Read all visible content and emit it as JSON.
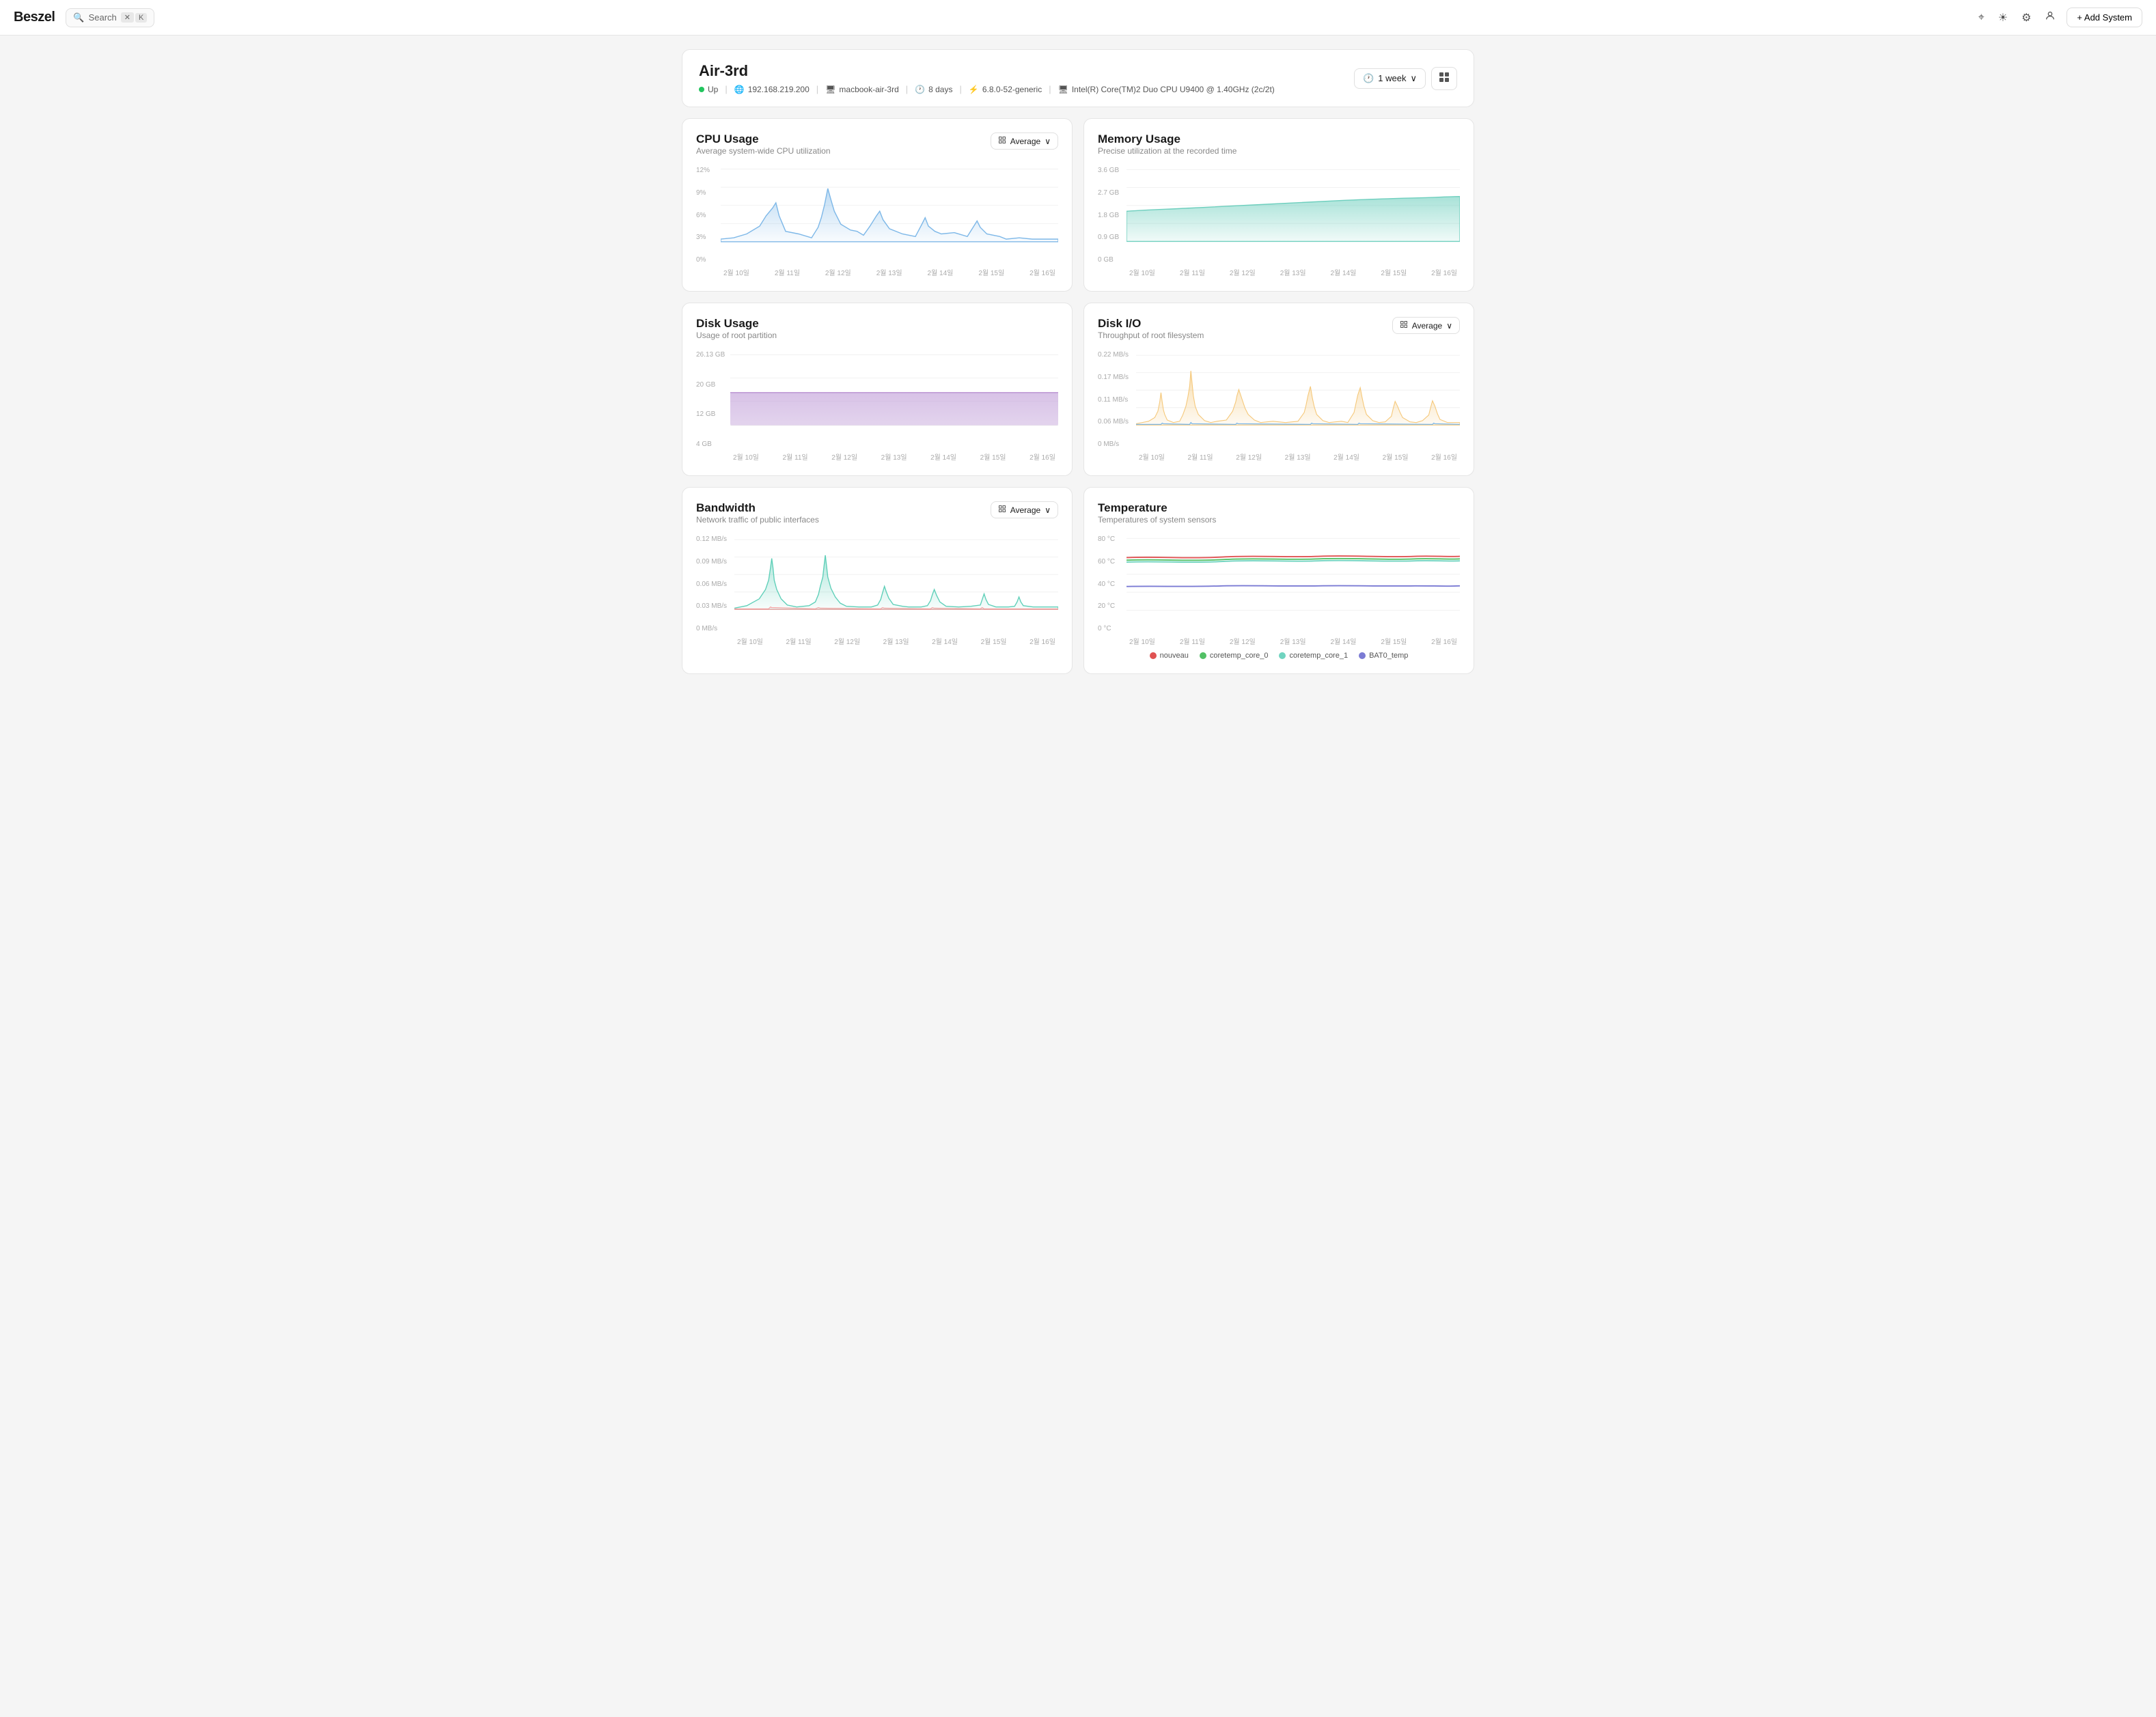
{
  "header": {
    "logo": "Beszel",
    "search": {
      "placeholder": "Search",
      "shortcut_x": "✕",
      "shortcut_k": "K"
    },
    "icons": {
      "translate": "⌖",
      "sun": "☀",
      "settings": "⚙",
      "user": "👤"
    },
    "add_system_label": "+ Add System"
  },
  "system": {
    "name": "Air-3rd",
    "status": "Up",
    "ip": "192.168.219.200",
    "hostname": "macbook-air-3rd",
    "uptime": "8 days",
    "kernel": "6.8.0-52-generic",
    "cpu": "Intel(R) Core(TM)2 Duo CPU U9400 @ 1.40GHz (2c/2t)"
  },
  "controls": {
    "time_period": "1 week",
    "time_icon": "🕐",
    "chevron": "∨"
  },
  "charts": {
    "cpu": {
      "title": "CPU Usage",
      "subtitle": "Average system-wide CPU utilization",
      "selector_label": "Average",
      "y_labels": [
        "12%",
        "9%",
        "6%",
        "3%",
        "0%"
      ],
      "x_labels": [
        "2월 10일",
        "2월 11일",
        "2월 12일",
        "2월 13일",
        "2월 14일",
        "2월 15일",
        "2월 16일"
      ],
      "color": "#7eb8e8"
    },
    "memory": {
      "title": "Memory Usage",
      "subtitle": "Precise utilization at the recorded time",
      "y_labels": [
        "3.6 GB",
        "2.7 GB",
        "1.8 GB",
        "0.9 GB",
        "0 GB"
      ],
      "x_labels": [
        "2월 10일",
        "2월 11일",
        "2월 12일",
        "2월 13일",
        "2월 14일",
        "2월 15일",
        "2월 16일"
      ],
      "color": "#6ecfbe"
    },
    "disk_usage": {
      "title": "Disk Usage",
      "subtitle": "Usage of root partition",
      "y_labels": [
        "26.13 GB",
        "20 GB",
        "12 GB",
        "4 GB"
      ],
      "x_labels": [
        "2월 10일",
        "2월 11일",
        "2월 12일",
        "2월 13일",
        "2월 14일",
        "2월 15일",
        "2월 16일"
      ],
      "color": "#c7a8dc"
    },
    "disk_io": {
      "title": "Disk I/O",
      "subtitle": "Throughput of root filesystem",
      "selector_label": "Average",
      "y_labels": [
        "0.22 MB/s",
        "0.17 MB/s",
        "0.11 MB/s",
        "0.06 MB/s",
        "0 MB/s"
      ],
      "x_labels": [
        "2월 10일",
        "2월 11일",
        "2월 12일",
        "2월 13일",
        "2월 14일",
        "2월 15일",
        "2월 16일"
      ],
      "color": "#f5c87a"
    },
    "bandwidth": {
      "title": "Bandwidth",
      "subtitle": "Network traffic of public interfaces",
      "selector_label": "Average",
      "y_labels": [
        "0.12 MB/s",
        "0.09 MB/s",
        "0.06 MB/s",
        "0.03 MB/s",
        "0 MB/s"
      ],
      "x_labels": [
        "2월 10일",
        "2월 11일",
        "2월 12일",
        "2월 13일",
        "2월 14일",
        "2월 15일",
        "2월 16일"
      ],
      "color": "#5ecfb8"
    },
    "temperature": {
      "title": "Temperature",
      "subtitle": "Temperatures of system sensors",
      "y_labels": [
        "80 °C",
        "60 °C",
        "40 °C",
        "20 °C",
        "0 °C"
      ],
      "x_labels": [
        "2월 10일",
        "2월 11일",
        "2월 12일",
        "2월 13일",
        "2월 14일",
        "2월 15일",
        "2월 16일"
      ],
      "legend": [
        {
          "label": "nouveau",
          "color": "#e05252"
        },
        {
          "label": "coretemp_core_0",
          "color": "#52c065"
        },
        {
          "label": "coretemp_core_1",
          "color": "#70d4c0"
        },
        {
          "label": "BAT0_temp",
          "color": "#7b7bd4"
        }
      ]
    }
  }
}
